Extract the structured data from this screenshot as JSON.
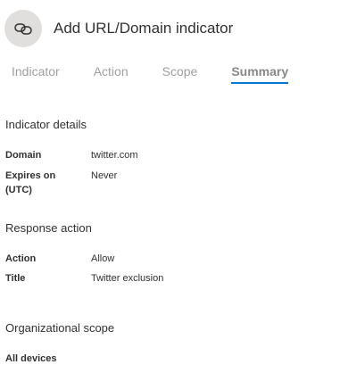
{
  "header": {
    "title": "Add URL/Domain indicator",
    "icon": "link-icon"
  },
  "tabs": [
    {
      "label": "Indicator",
      "active": false
    },
    {
      "label": "Action",
      "active": false
    },
    {
      "label": "Scope",
      "active": false
    },
    {
      "label": "Summary",
      "active": true
    }
  ],
  "indicator_details": {
    "heading": "Indicator details",
    "rows": [
      {
        "label": "Domain",
        "value": "twitter.com"
      },
      {
        "label": "Expires on (UTC)",
        "value": "Never"
      }
    ]
  },
  "response_action": {
    "heading": "Response action",
    "rows": [
      {
        "label": "Action",
        "value": "Allow"
      },
      {
        "label": "Title",
        "value": "Twitter exclusion"
      }
    ]
  },
  "organizational_scope": {
    "heading": "Organizational scope",
    "value": "All devices"
  },
  "colors": {
    "accent": "#0078d4",
    "icon_bg": "#e1dfdd"
  }
}
